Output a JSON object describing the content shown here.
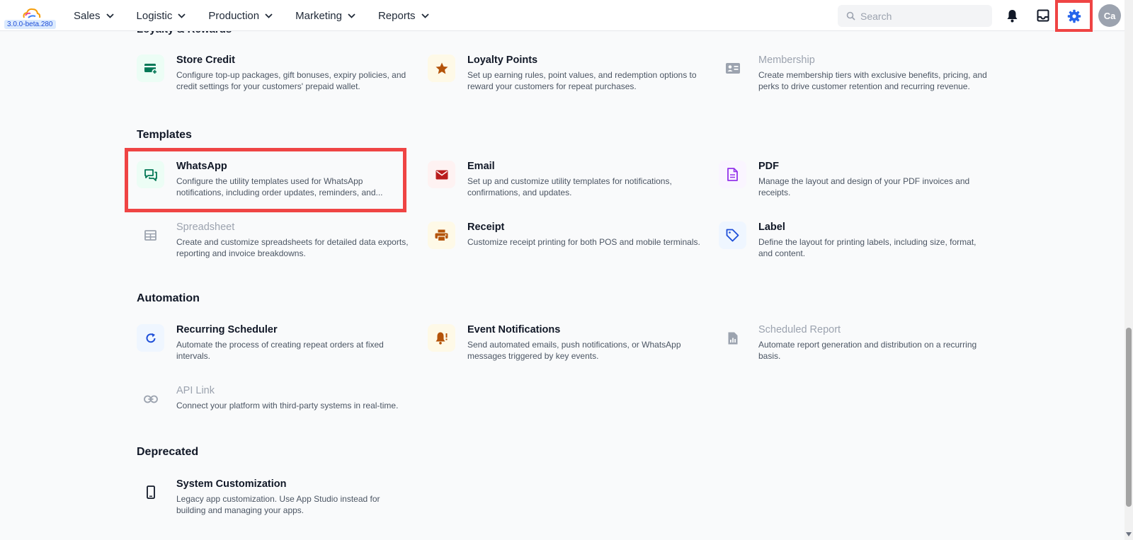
{
  "app": {
    "version": "3.0.0-beta.280"
  },
  "nav": [
    {
      "label": "Sales"
    },
    {
      "label": "Logistic"
    },
    {
      "label": "Production"
    },
    {
      "label": "Marketing"
    },
    {
      "label": "Reports"
    }
  ],
  "search": {
    "placeholder": "Search",
    "value": ""
  },
  "user": {
    "initials": "Ca"
  },
  "colors": {
    "accent": "#2563eb",
    "highlight": "#ef4444"
  },
  "cutoff_section": "Loyalty & Rewards",
  "sections": {
    "loyalty": {
      "cards": [
        {
          "title": "Store Credit",
          "desc": "Configure top-up packages, gift bonuses, expiry policies, and credit settings for your customers' prepaid wallet.",
          "icon": "wallet-add-icon"
        },
        {
          "title": "Loyalty Points",
          "desc": "Set up earning rules, point values, and redemption options to reward your customers for repeat purchases.",
          "icon": "star-icon"
        },
        {
          "title": "Membership",
          "desc": "Create membership tiers with exclusive benefits, pricing, and perks to drive customer retention and recurring revenue.",
          "icon": "id-card-icon"
        }
      ]
    },
    "templates": {
      "title": "Templates",
      "cards": [
        {
          "title": "WhatsApp",
          "desc": "Configure the utility templates used for WhatsApp notifications, including order updates, reminders, and...",
          "icon": "chat-icon"
        },
        {
          "title": "Email",
          "desc": "Set up and customize utility templates for notifications, confirmations, and updates.",
          "icon": "mail-icon"
        },
        {
          "title": "PDF",
          "desc": "Manage the layout and design of your PDF invoices and receipts.",
          "icon": "document-icon"
        },
        {
          "title": "Spreadsheet",
          "desc": "Create and customize spreadsheets for detailed data exports, reporting and invoice breakdowns.",
          "icon": "table-icon"
        },
        {
          "title": "Receipt",
          "desc": "Customize receipt printing for both POS and mobile terminals.",
          "icon": "printer-icon"
        },
        {
          "title": "Label",
          "desc": "Define the layout for printing labels, including size, format, and content.",
          "icon": "tag-icon"
        }
      ]
    },
    "automation": {
      "title": "Automation",
      "cards": [
        {
          "title": "Recurring Scheduler",
          "desc": "Automate the process of creating repeat orders at fixed intervals.",
          "icon": "refresh-icon"
        },
        {
          "title": "Event Notifications",
          "desc": "Send automated emails, push notifications, or WhatsApp messages triggered by key events.",
          "icon": "bell-alert-icon"
        },
        {
          "title": "Scheduled Report",
          "desc": "Automate report generation and distribution on a recurring basis.",
          "icon": "report-icon"
        },
        {
          "title": "API Link",
          "desc": "Connect your platform with third-party systems in real-time.",
          "icon": "link-icon"
        }
      ]
    },
    "deprecated": {
      "title": "Deprecated",
      "cards": [
        {
          "title": "System Customization",
          "desc": "Legacy app customization. Use App Studio instead for building and managing your apps.",
          "icon": "phone-icon"
        }
      ]
    }
  }
}
